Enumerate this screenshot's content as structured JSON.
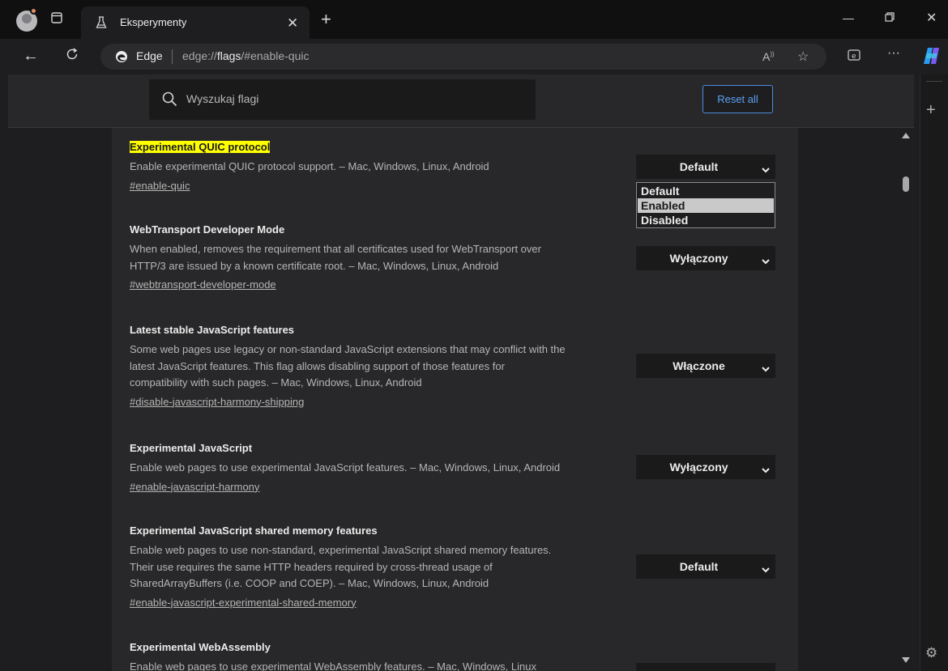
{
  "browser": {
    "tab_title": "Eksperymenty",
    "site_name": "Edge",
    "url_prefix": "edge://",
    "url_host": "flags",
    "url_rest": "/#enable-quic"
  },
  "header": {
    "search_placeholder": "Wyszukaj flagi",
    "reset_label": "Reset all"
  },
  "flags": [
    {
      "title": "Experimental QUIC protocol",
      "description": "Enable experimental QUIC protocol support. – Mac, Windows, Linux, Android",
      "link": "#enable-quic",
      "value": "Default"
    },
    {
      "title": "WebTransport Developer Mode",
      "description_lines": [
        "When enabled, removes the requirement that all certificates used for WebTransport over",
        "HTTP/3 are issued by a known certificate root. – Mac, Windows, Linux, Android"
      ],
      "link": "#webtransport-developer-mode",
      "value": "Wyłączony"
    },
    {
      "title": "Latest stable JavaScript features",
      "description_lines": [
        "Some web pages use legacy or non-standard JavaScript extensions that may conflict with the",
        "latest JavaScript features. This flag allows disabling support of those features for",
        "compatibility with such pages. – Mac, Windows, Linux, Android"
      ],
      "link": "#disable-javascript-harmony-shipping",
      "value": "Włączone"
    },
    {
      "title": "Experimental JavaScript",
      "description": "Enable web pages to use experimental JavaScript features. – Mac, Windows, Linux, Android",
      "link": "#enable-javascript-harmony",
      "value": "Wyłączony"
    },
    {
      "title": "Experimental JavaScript shared memory features",
      "description_lines": [
        "Enable web pages to use non-standard, experimental JavaScript shared memory features.",
        "Their use requires the same HTTP headers required by cross-thread usage of",
        "SharedArrayBuffers (i.e. COOP and COEP). – Mac, Windows, Linux, Android"
      ],
      "link": "#enable-javascript-experimental-shared-memory",
      "value": "Default"
    },
    {
      "title": "Experimental WebAssembly",
      "description": "Enable web pages to use experimental WebAssembly features. – Mac, Windows, Linux"
    }
  ],
  "dropdown": {
    "options": [
      "Default",
      "Enabled",
      "Disabled"
    ],
    "highlighted": "Enabled"
  },
  "colors": {
    "highlight": "#ffff00",
    "accent": "#4a8ce0"
  }
}
